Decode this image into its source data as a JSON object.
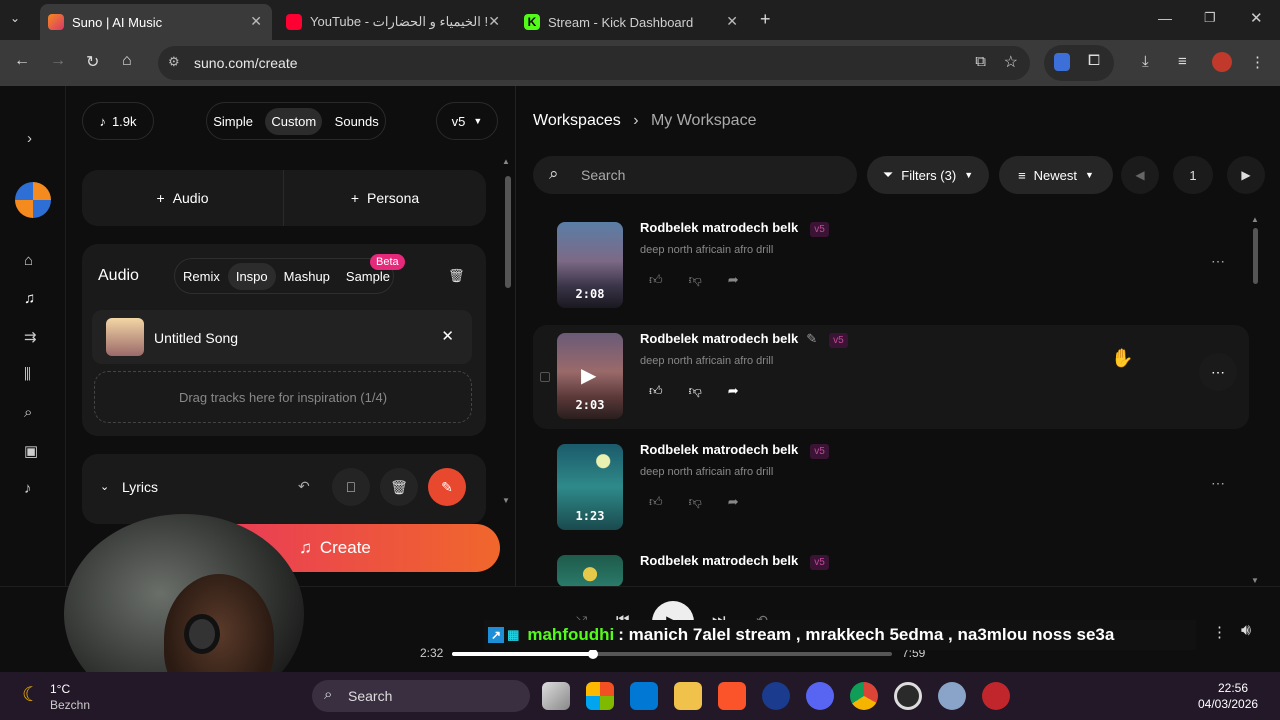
{
  "browser": {
    "tabs": [
      {
        "title": "Suno | AI Music",
        "active": true
      },
      {
        "title": "YouTube - الخيمياء و الحضارات !",
        "active": false
      },
      {
        "title": "Stream - Kick Dashboard",
        "active": false
      }
    ],
    "url": "suno.com/create"
  },
  "left": {
    "notes_count": "1.9k",
    "modes": [
      "Simple",
      "Custom",
      "Sounds"
    ],
    "selected_mode": "Custom",
    "model": "v5",
    "add_audio": "Audio",
    "add_persona": "Persona",
    "audio_title": "Audio",
    "audio_modes": [
      "Remix",
      "Inspo",
      "Mashup",
      "Sample"
    ],
    "selected_audio_mode": "Inspo",
    "beta_badge": "Beta",
    "song_name": "Untitled Song",
    "dropzone_text": "Drag tracks here for inspiration (1/4)",
    "lyrics_label": "Lyrics",
    "create_label": "Create"
  },
  "right": {
    "breadcrumb_root": "Workspaces",
    "breadcrumb_current": "My Workspace",
    "search_placeholder": "Search",
    "filters_label": "Filters (3)",
    "sort_label": "Newest",
    "page": "1",
    "tracks": [
      {
        "title": "Rodbelek matrodech belk",
        "version": "v5",
        "desc": "deep north africain afro drill",
        "duration": "2:08"
      },
      {
        "title": "Rodbelek matrodech belk",
        "version": "v5",
        "desc": "deep north africain afro drill",
        "duration": "2:03"
      },
      {
        "title": "Rodbelek matrodech belk",
        "version": "v5",
        "desc": "deep north africain afro drill",
        "duration": "1:23"
      },
      {
        "title": "Rodbelek matrodech belk",
        "version": "v5",
        "desc": "",
        "duration": ""
      }
    ]
  },
  "player": {
    "elapsed": "2:32",
    "total": "7:59",
    "progress_fraction": 0.32
  },
  "chat": {
    "username": "mahfoudhi",
    "message": ": manich 7alel stream , mrakkech 5edma , na3mlou noss se3a"
  },
  "taskbar": {
    "weather_temp": "1°C",
    "weather_loc": "Bezchn",
    "search_label": "Search",
    "time": "22:56",
    "date": "04/03/2026"
  },
  "colors": {
    "accent_pink": "#e6297a",
    "create_gradient_start": "#e8345e",
    "create_gradient_end": "#f0672c",
    "kick_green": "#53fc18"
  }
}
